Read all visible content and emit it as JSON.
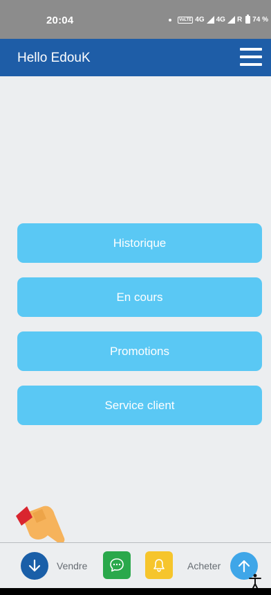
{
  "status_bar": {
    "time": "20:04",
    "network_badge": "VoLTE",
    "network_1": "4G",
    "network_2": "4G",
    "roaming": "R",
    "battery": "74 %"
  },
  "app_bar": {
    "title": "Hello EdouK",
    "menu_icon": "hamburger-menu-icon"
  },
  "main_buttons": [
    {
      "label": "Historique"
    },
    {
      "label": "En cours"
    },
    {
      "label": "Promotions"
    },
    {
      "label": "Service client"
    }
  ],
  "bottom_bar": {
    "vendre_label": "Vendre",
    "acheter_label": "Acheter",
    "vendre_icon": "arrow-down-icon",
    "chat_icon": "chat-bubble-icon",
    "bell_icon": "bell-icon",
    "acheter_icon": "arrow-up-icon"
  },
  "colors": {
    "app_bar": "#1e5da7",
    "button": "#5ac8f4",
    "background": "#eceef0",
    "status_bar": "#8c8c8c",
    "vendre": "#1a5fa8",
    "chat": "#2aa84b",
    "bell": "#f6c52c",
    "acheter": "#3fa6e8"
  }
}
